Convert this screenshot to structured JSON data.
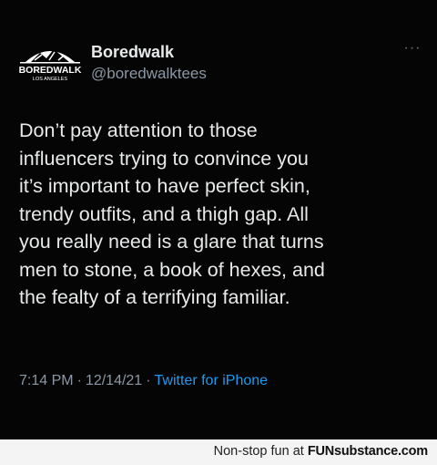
{
  "tweet": {
    "display_name": "Boredwalk",
    "handle": "@boredwalktees",
    "avatar": {
      "brand_text": "BOREDWALK",
      "sub_text": "LOS ANGELES"
    },
    "more_label": "···",
    "text_lines": [
      "Don’t pay attention to those",
      "influencers trying to convince you",
      "it’s important to have perfect skin,",
      "trendy outfits, and a thigh gap. All",
      "you really need is a glare that turns",
      "men to stone, a book of hexes, and",
      "the fealty of a terrifying familiar."
    ],
    "time": "7:14 PM",
    "date": "12/14/21",
    "separator": "·",
    "source": "Twitter for iPhone"
  },
  "footer": {
    "prefix": "Non-stop fun at",
    "brand": "FUNsubstance.com"
  },
  "colors": {
    "background": "#000000",
    "text": "#e7e9ea",
    "secondary": "#8b98a5",
    "link": "#1d9bf0"
  }
}
